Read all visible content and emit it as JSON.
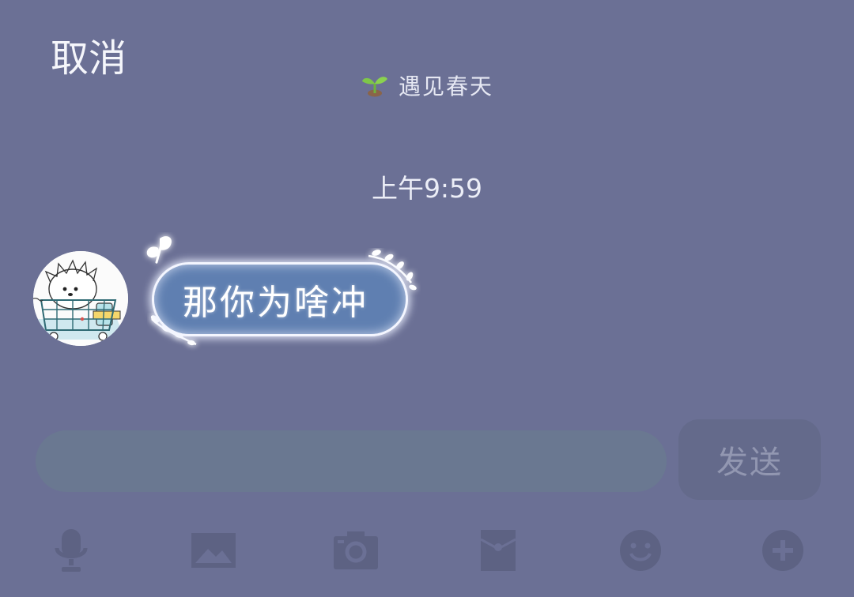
{
  "header": {
    "cancel_label": "取消",
    "contact_name": "遇见春天",
    "contact_icon": "sprout-icon"
  },
  "conversation": {
    "timestamp": "上午9:59",
    "messages": [
      {
        "sender": "contact",
        "avatar_icon": "hedgehog-in-shopping-cart-avatar",
        "text": "那你为啥冲"
      }
    ]
  },
  "composer": {
    "input_value": "",
    "send_label": "发送"
  },
  "toolbar": {
    "icons": [
      "microphone-icon",
      "image-icon",
      "camera-icon",
      "red-packet-icon",
      "emoji-icon",
      "plus-icon"
    ]
  },
  "colors": {
    "background": "#6b7095",
    "bubble_fill": "#5f7fb1",
    "bubble_glow": "#f4f6ff",
    "input_bar": "#6a7891",
    "send_button": "#646a8b",
    "toolbar_icon": "#5d6283",
    "contact_icon_green": "#7ec64a"
  }
}
